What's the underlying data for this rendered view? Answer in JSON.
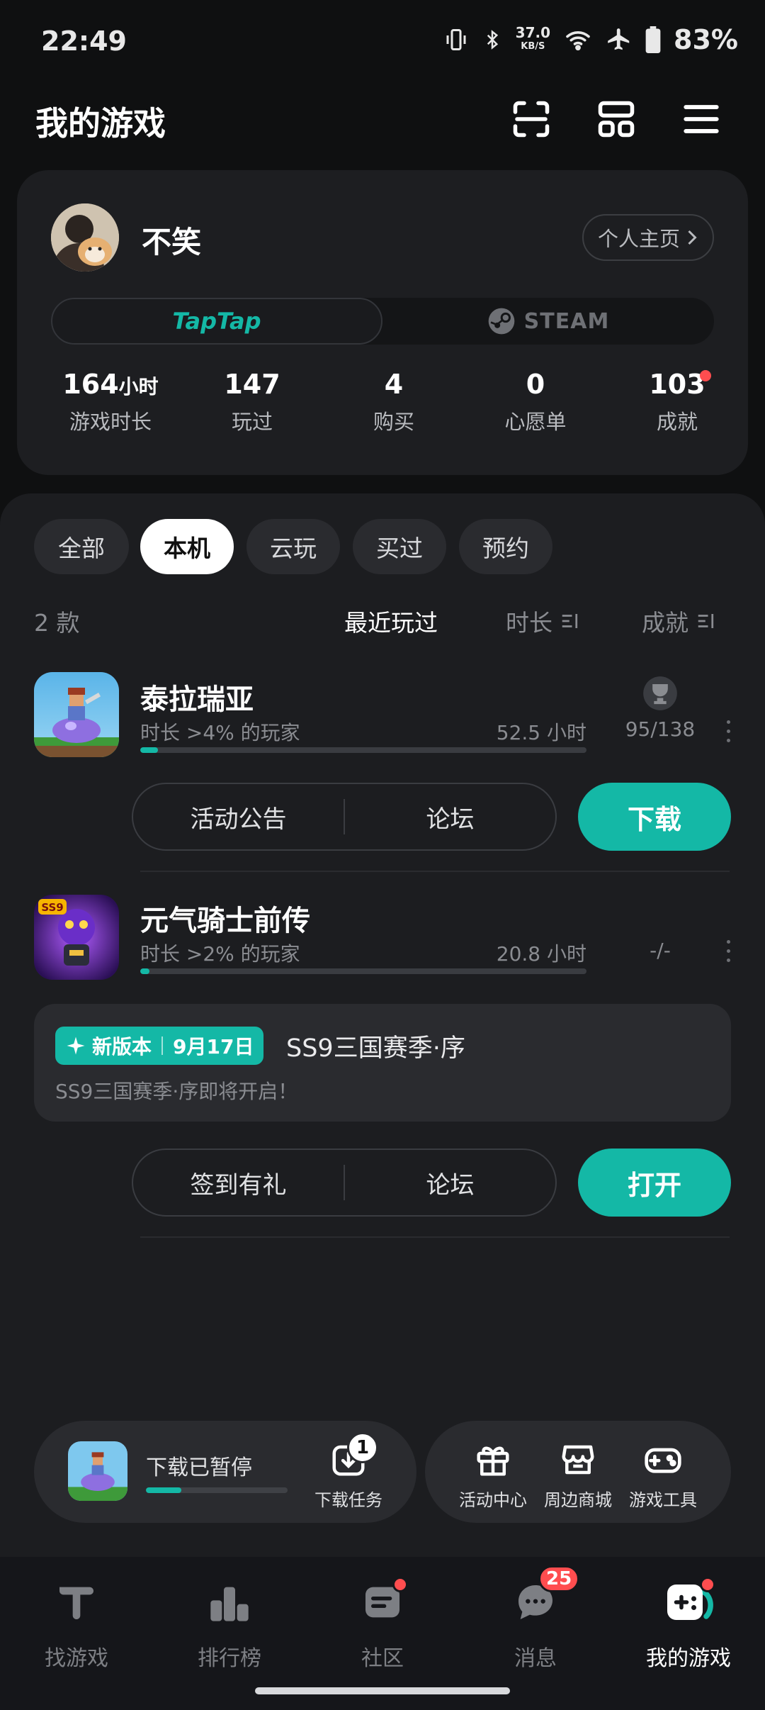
{
  "status": {
    "time": "22:49",
    "speed_value": "37.0",
    "speed_unit": "KB/S",
    "battery": "83%"
  },
  "header": {
    "title": "我的游戏"
  },
  "profile": {
    "name": "不笑",
    "home_link": "个人主页",
    "platform_tabs": [
      "TapTap",
      "STEAM"
    ],
    "stats": [
      {
        "value": "164",
        "unit": "小时",
        "label": "游戏时长"
      },
      {
        "value": "147",
        "unit": "",
        "label": "玩过"
      },
      {
        "value": "4",
        "unit": "",
        "label": "购买"
      },
      {
        "value": "0",
        "unit": "",
        "label": "心愿单"
      },
      {
        "value": "103",
        "unit": "",
        "label": "成就"
      }
    ]
  },
  "filters": {
    "chips": [
      "全部",
      "本机",
      "云玩",
      "买过",
      "预约"
    ],
    "active": "本机"
  },
  "list_header": {
    "count": "2 款",
    "sort_recent": "最近玩过",
    "sort_duration": "时长",
    "sort_achievement": "成就"
  },
  "games": [
    {
      "title": "泰拉瑞亚",
      "subtitle": "时长 >4% 的玩家",
      "hours": "52.5 小时",
      "progress": 0.04,
      "achievements": "95/138",
      "actions": [
        "活动公告",
        "论坛"
      ],
      "primary": "下载"
    },
    {
      "title": "元气骑士前传",
      "subtitle": "时长 >2% 的玩家",
      "hours": "20.8 小时",
      "progress": 0.02,
      "achievements": "-/-",
      "news": {
        "badge": "新版本",
        "date": "9月17日",
        "title": "SS9三国赛季·序",
        "desc": "SS9三国赛季·序即将开启！"
      },
      "actions": [
        "签到有礼",
        "论坛"
      ],
      "primary": "打开"
    }
  ],
  "download_dock": {
    "status": "下载已暂停",
    "progress": 0.25,
    "task_label": "下载任务",
    "task_count": "1"
  },
  "shortcut_dock": [
    "活动中心",
    "周边商城",
    "游戏工具"
  ],
  "nav": {
    "items": [
      "找游戏",
      "排行榜",
      "社区",
      "消息",
      "我的游戏"
    ],
    "active": "我的游戏",
    "message_badge": "25"
  },
  "colors": {
    "accent": "#14b8a6",
    "badge_red": "#ff4d4f",
    "background": "#0f1011"
  }
}
